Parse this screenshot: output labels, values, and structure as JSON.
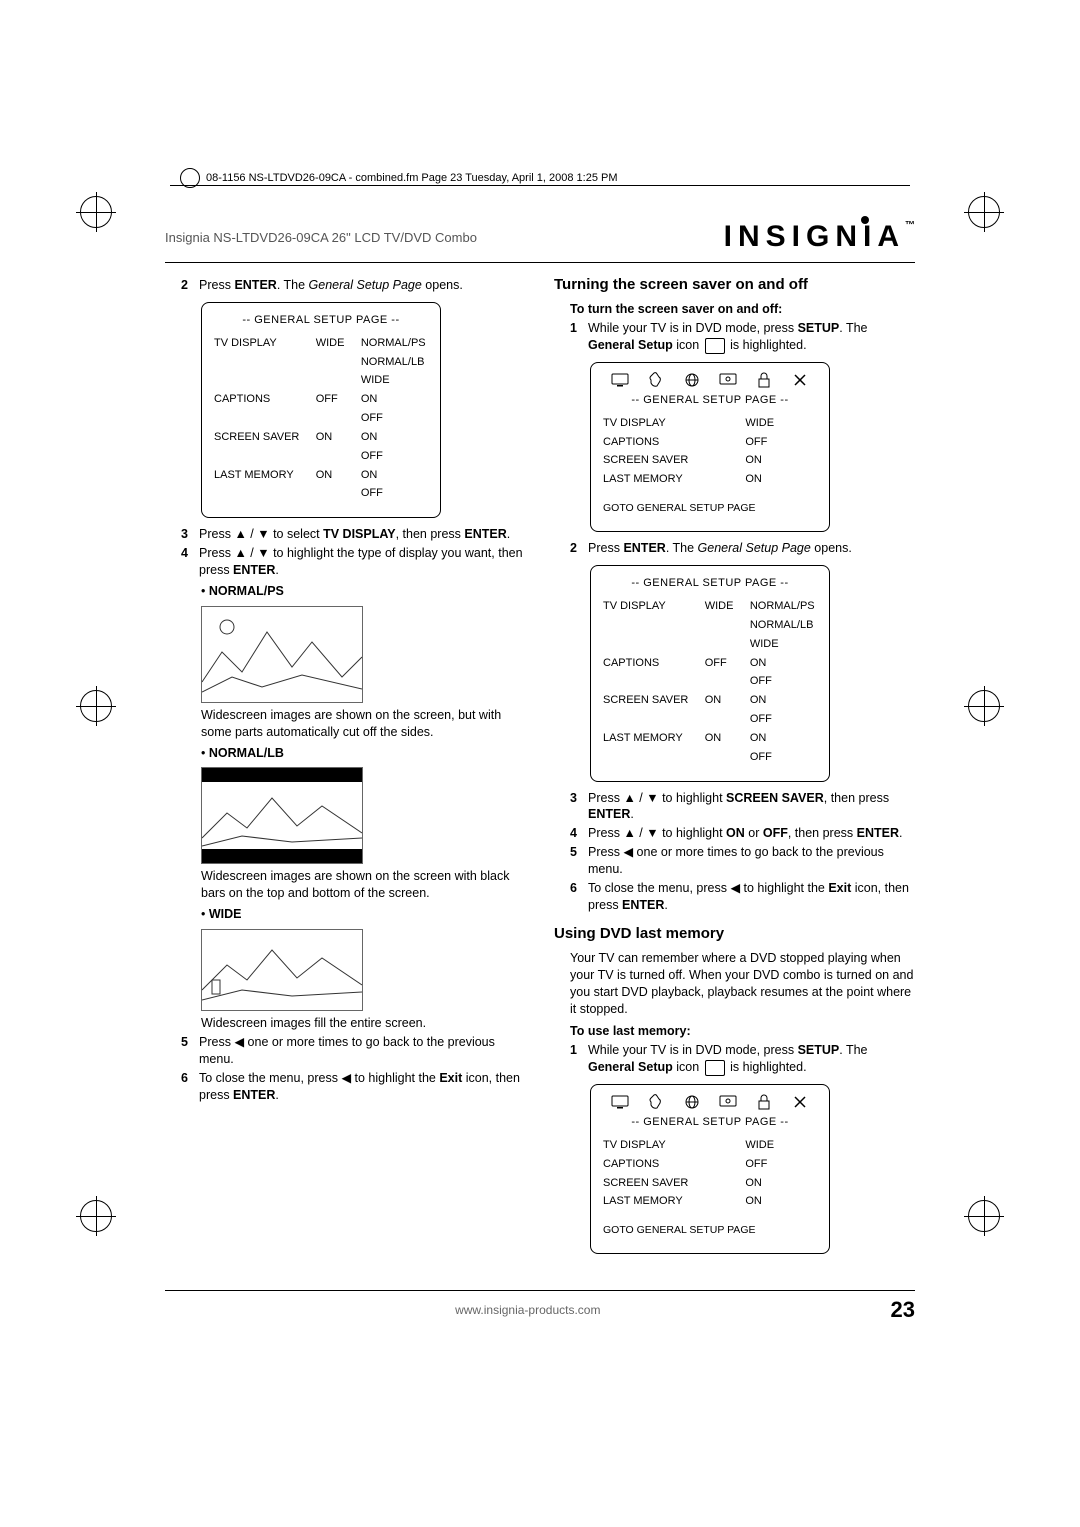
{
  "print_meta": "08-1156 NS-LTDVD26-09CA - combined.fm  Page 23  Tuesday, April 1, 2008  1:25 PM",
  "header": {
    "product": "Insignia NS-LTDVD26-09CA 26\" LCD TV/DVD Combo",
    "brand": "INSIGNIA",
    "brand_tm": "™"
  },
  "left": {
    "step2_a": "Press ",
    "step2_enter": "ENTER",
    "step2_b": ". The ",
    "step2_page": "General Setup Page",
    "step2_c": " opens.",
    "osd1": {
      "title": "--  GENERAL SETUP PAGE  --",
      "rows": [
        [
          "TV DISPLAY",
          "WIDE",
          "NORMAL/PS"
        ],
        [
          "",
          "",
          "NORMAL/LB"
        ],
        [
          "",
          "",
          "WIDE"
        ],
        [
          "CAPTIONS",
          "OFF",
          "ON"
        ],
        [
          "",
          "",
          "OFF"
        ],
        [
          "SCREEN SAVER",
          "ON",
          "ON"
        ],
        [
          "",
          "",
          "OFF"
        ],
        [
          "LAST MEMORY",
          "ON",
          "ON"
        ],
        [
          "",
          "",
          "OFF"
        ]
      ]
    },
    "step3_a": "Press ",
    "step3_sym": "▲ / ▼",
    "step3_b": " to select ",
    "step3_tv": "TV DISPLAY",
    "step3_c": ", then press ",
    "step3_enter": "ENTER",
    "step3_d": ".",
    "step4_a": "Press ",
    "step4_sym": "▲ / ▼",
    "step4_b": " to highlight the type of display you want, then press ",
    "step4_enter": "ENTER",
    "step4_c": ".",
    "b1_label": "NORMAL/PS",
    "b1_text": "Widescreen images are shown on the screen, but with some parts automatically cut off the sides.",
    "b2_label": "NORMAL/LB",
    "b2_text": "Widescreen images are shown on the screen with black bars on the top and bottom of the screen.",
    "b3_label": "WIDE",
    "b3_text": "Widescreen images fill the entire screen.",
    "step5_a": "Press ",
    "step5_sym": "◀",
    "step5_b": " one or more times to go back to the previous menu.",
    "step6_a": "To close the menu, press ",
    "step6_sym": "◀",
    "step6_b": " to highlight the ",
    "step6_exit": "Exit",
    "step6_c": " icon, then press ",
    "step6_enter": "ENTER",
    "step6_d": "."
  },
  "right": {
    "h1": "Turning the screen saver on and off",
    "sub1": "To turn the screen saver on and off:",
    "r_step1_a": "While your TV is in DVD mode, press ",
    "r_step1_setup": "SETUP",
    "r_step1_b": ". The ",
    "r_step1_gs": "General Setup",
    "r_step1_c": " icon ",
    "r_step1_d": " is highlighted.",
    "osd2": {
      "title": "--  GENERAL SETUP PAGE  --",
      "rows2": [
        [
          "TV DISPLAY",
          "WIDE"
        ],
        [
          "CAPTIONS",
          "OFF"
        ],
        [
          "SCREEN SAVER",
          "ON"
        ],
        [
          "LAST MEMORY",
          "ON"
        ]
      ],
      "foot": "GOTO GENERAL SETUP PAGE"
    },
    "r_step2_a": "Press ",
    "r_step2_enter": "ENTER",
    "r_step2_b": ". The ",
    "r_step2_page": "General Setup Page",
    "r_step2_c": " opens.",
    "osd3": {
      "title": "--  GENERAL SETUP PAGE  --",
      "rows": [
        [
          "TV DISPLAY",
          "WIDE",
          "NORMAL/PS"
        ],
        [
          "",
          "",
          "NORMAL/LB"
        ],
        [
          "",
          "",
          "WIDE"
        ],
        [
          "CAPTIONS",
          "OFF",
          "ON"
        ],
        [
          "",
          "",
          "OFF"
        ],
        [
          "SCREEN SAVER",
          "ON",
          "ON"
        ],
        [
          "",
          "",
          "OFF"
        ],
        [
          "LAST MEMORY",
          "ON",
          "ON"
        ],
        [
          "",
          "",
          "OFF"
        ]
      ]
    },
    "r_step3_a": "Press ",
    "r_step3_sym": "▲ / ▼",
    "r_step3_b": " to highlight ",
    "r_step3_ss": "SCREEN SAVER",
    "r_step3_c": ", then press ",
    "r_step3_enter": "ENTER",
    "r_step3_d": ".",
    "r_step4_a": "Press ",
    "r_step4_sym": "▲ / ▼",
    "r_step4_b": " to highlight ",
    "r_step4_on": "ON",
    "r_step4_or": " or ",
    "r_step4_off": "OFF",
    "r_step4_c": ", then press ",
    "r_step4_enter": "ENTER",
    "r_step4_d": ".",
    "r_step5_a": "Press ",
    "r_step5_sym": "◀",
    "r_step5_b": " one or more times to go back to the previous menu.",
    "r_step6_a": "To close the menu, press ",
    "r_step6_sym": "◀",
    "r_step6_b": " to highlight the ",
    "r_step6_exit": "Exit",
    "r_step6_c": " icon, then press ",
    "r_step6_enter": "ENTER",
    "r_step6_d": ".",
    "h2": "Using DVD last memory",
    "h2_body": "Your TV can remember where a DVD stopped playing when your TV is turned off. When your DVD combo is turned on and you start DVD playback, playback resumes at the point where it stopped.",
    "sub2": "To use last memory:",
    "lm_step1_a": "While your TV is in DVD mode, press ",
    "lm_step1_setup": "SETUP",
    "lm_step1_b": ". The ",
    "lm_step1_gs": "General Setup",
    "lm_step1_c": " icon ",
    "lm_step1_d": " is highlighted.",
    "osd4": {
      "title": "--  GENERAL SETUP PAGE  --",
      "rows2": [
        [
          "TV DISPLAY",
          "WIDE"
        ],
        [
          "CAPTIONS",
          "OFF"
        ],
        [
          "SCREEN SAVER",
          "ON"
        ],
        [
          "LAST MEMORY",
          "ON"
        ]
      ],
      "foot": "GOTO GENERAL SETUP PAGE"
    }
  },
  "footer": {
    "url": "www.insignia-products.com",
    "page": "23"
  },
  "nums": {
    "n1": "1",
    "n2": "2",
    "n3": "3",
    "n4": "4",
    "n5": "5",
    "n6": "6"
  },
  "bullet_dot": "•"
}
